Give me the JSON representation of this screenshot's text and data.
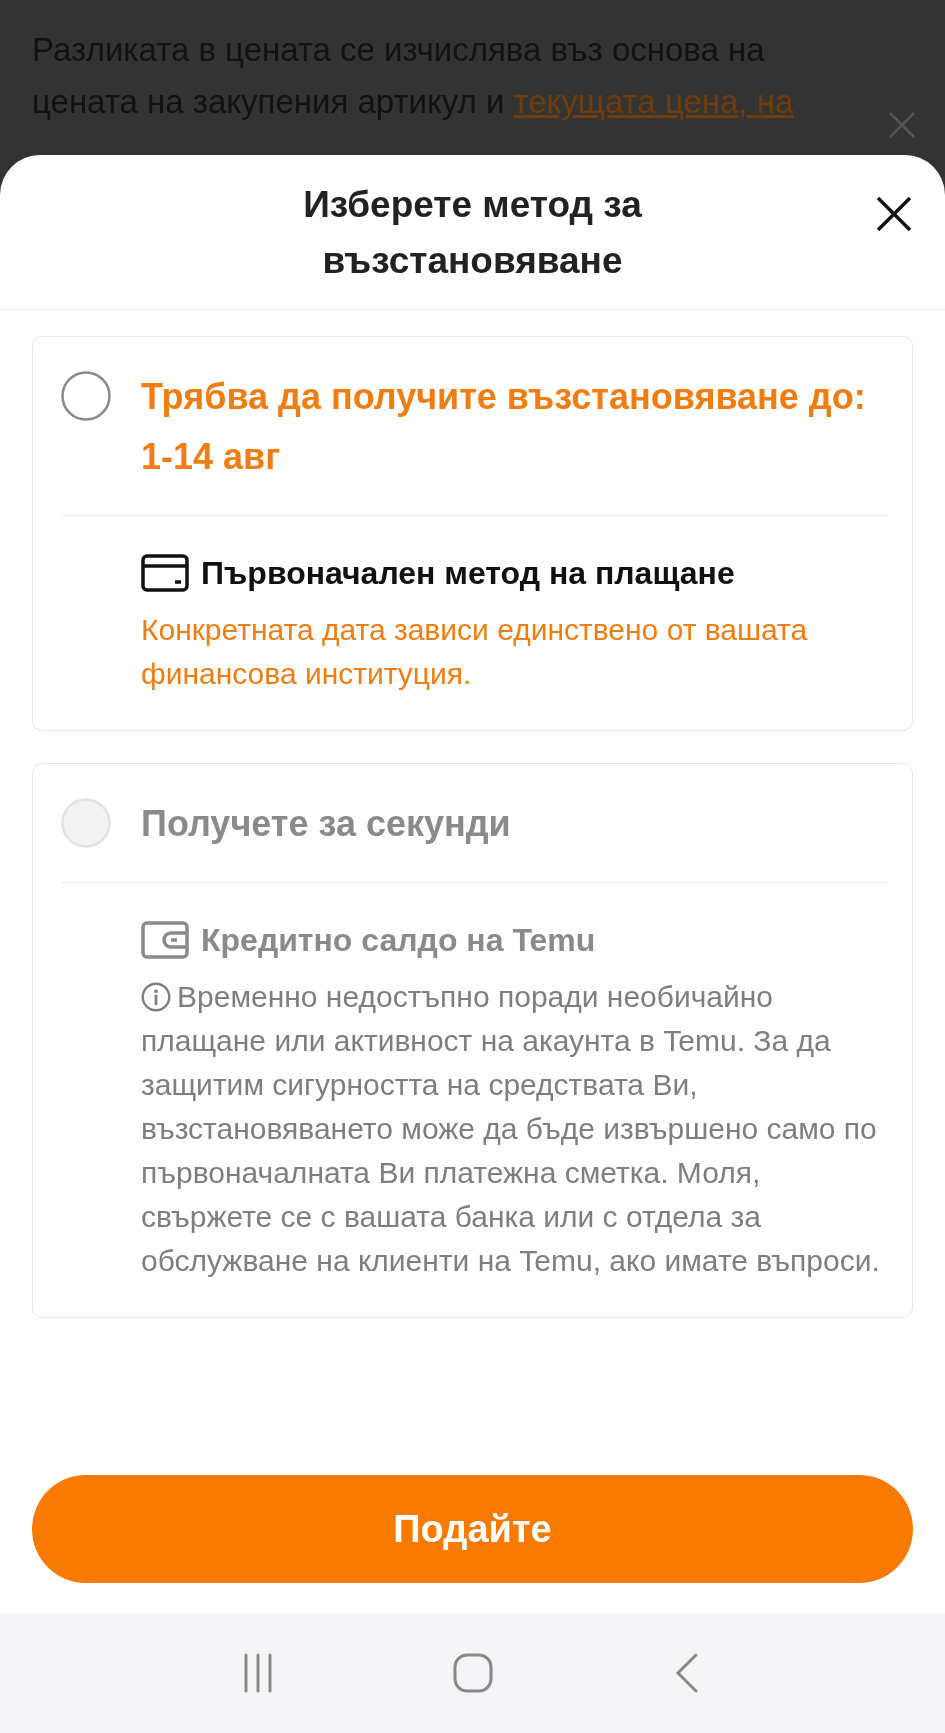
{
  "background": {
    "lines": [
      {
        "text": "Разликата в цената се изчислява въз основа на"
      },
      {
        "text": "цената на закупения артикул и",
        "link": "текущата цена, на"
      }
    ]
  },
  "sheet": {
    "title": "Изберете метод за възстановяване"
  },
  "options": [
    {
      "selected": false,
      "disabled": false,
      "title": "Трябва да получите възстановяване до: 1-14 авг",
      "kind": "card",
      "method": "Първоначален метод на плащане",
      "note": "Конкретната дата зависи единствено от вашата финансова институция."
    },
    {
      "selected": false,
      "disabled": true,
      "title": "Получете за секунди",
      "kind": "wallet",
      "method": "Кредитно салдо на Temu",
      "note": "Временно недостъпно поради необичайно плащане или активност на акаунта в Temu. За да защитим сигурността на средствата Ви, възстановяването може да бъде извършено само по първоначалната Ви платежна сметка. Моля, свържете се с вашата банка или с отдела за обслужване на клиенти на Temu, ако имате въпроси."
    }
  ],
  "submit": {
    "label": "Подайте"
  }
}
